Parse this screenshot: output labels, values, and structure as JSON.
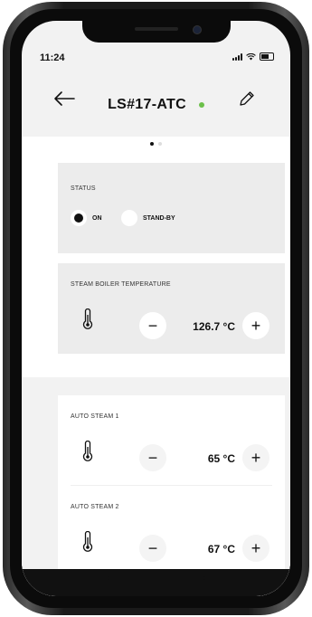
{
  "status_bar": {
    "time": "11:24"
  },
  "header": {
    "title": "LS#17-ATC",
    "online_color": "#6cc04a"
  },
  "pager": {
    "pages": 2,
    "active": 1
  },
  "status_card": {
    "label": "STATUS",
    "options": [
      {
        "label": "ON",
        "checked": true
      },
      {
        "label": "STAND-BY",
        "checked": false
      }
    ]
  },
  "steam_boiler": {
    "label": "STEAM BOILER TEMPERATURE",
    "value": "126.7 °C",
    "minus": "−",
    "plus": "+"
  },
  "auto_steam": [
    {
      "label": "AUTO STEAM 1",
      "value": "65 °C",
      "minus": "−",
      "plus": "+"
    },
    {
      "label": "AUTO STEAM 2",
      "value": "67 °C",
      "minus": "−",
      "plus": "+"
    }
  ],
  "icons": {
    "back": "arrow-left-icon",
    "edit": "pencil-icon",
    "thermometer": "thermometer-icon"
  }
}
